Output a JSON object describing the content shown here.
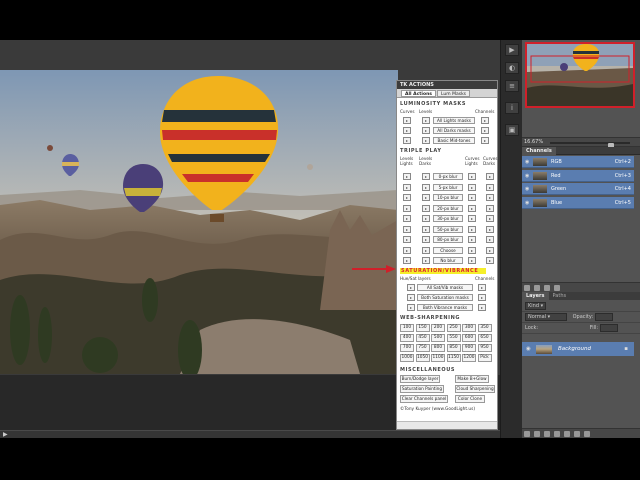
{
  "tk_panel": {
    "title": "TK ACTIONS",
    "tabs": [
      "All Actions",
      "Lum Masks"
    ],
    "luminosity": {
      "heading": "LUMINOSITY MASKS",
      "col_curves": "Curves",
      "col_levels": "Levels",
      "col_channels": "Channels",
      "buttons": [
        "All Lights masks",
        "All Darks masks",
        "Basic Mid-tones"
      ]
    },
    "triple_play": {
      "heading": "TRIPLE PLAY",
      "hdr_levels_lights": "Levels\nLights",
      "hdr_levels_darks": "Levels\nDarks",
      "hdr_curves_lights": "Curves\nLights",
      "hdr_curves_darks": "Curves\nDarks",
      "buttons": [
        "0-px blur",
        "5-px blur",
        "10-px blur",
        "20-px blur",
        "30-px blur",
        "50-px blur",
        "80-px blur",
        "Choose",
        "No blur"
      ]
    },
    "saturation": {
      "heading": "SATURATION/VIBRANCE",
      "sub_left": "Hue/Sat layers",
      "sub_right": "Channels",
      "buttons": [
        "All Sat/Vib masks",
        "Both Saturation masks",
        "Both Vibrance masks"
      ]
    },
    "web_sharpening": {
      "heading": "WEB-SHARPENING",
      "values": [
        [
          "100",
          "150",
          "200",
          "250",
          "300",
          "350"
        ],
        [
          "400",
          "450",
          "500",
          "550",
          "600",
          "650"
        ],
        [
          "700",
          "750",
          "800",
          "850",
          "900",
          "950"
        ],
        [
          "1000",
          "1050",
          "1100",
          "1150",
          "1200",
          "Pick"
        ]
      ]
    },
    "misc": {
      "heading": "MISCELLANEOUS",
      "buttons": [
        [
          "Burn/Dodge layer",
          "Make B+Glow"
        ],
        [
          "Saturation Painting",
          "Cloud Sharpening"
        ],
        [
          "Clear Channels panel",
          "Color Clone"
        ]
      ]
    },
    "footer": "©Tony Kuyper (www.GoodLight.us)"
  },
  "navigator": {
    "zoom": "16.67%"
  },
  "channels": {
    "tab": "Channels",
    "rows": [
      {
        "name": "RGB",
        "shortcut": "Ctrl+2"
      },
      {
        "name": "Red",
        "shortcut": "Ctrl+3"
      },
      {
        "name": "Green",
        "shortcut": "Ctrl+4"
      },
      {
        "name": "Blue",
        "shortcut": "Ctrl+5"
      }
    ]
  },
  "layers": {
    "tabs": [
      "Layers",
      "Paths"
    ],
    "kind": "Kind",
    "blend": "Normal",
    "opacity_label": "Opacity:",
    "lock_label": "Lock:",
    "fill_label": "Fill:",
    "layer_name": "Background"
  },
  "colors": {
    "selection_blue": "#5a7db0",
    "annotation_red": "#d0202a",
    "highlight_yellow": "#f5ef2a"
  }
}
